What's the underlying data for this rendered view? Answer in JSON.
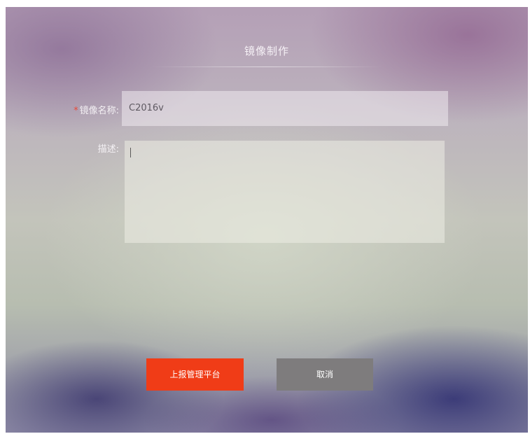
{
  "dialog": {
    "title": "镜像制作"
  },
  "form": {
    "name": {
      "required_mark": "*",
      "label": "镜像名称:",
      "value": "C2016v"
    },
    "description": {
      "label": "描述:",
      "value": ""
    }
  },
  "buttons": {
    "submit_label": "上报管理平台",
    "cancel_label": "取消"
  },
  "colors": {
    "accent": "#f03c17",
    "cancel": "#7e7c7d",
    "required": "#e84a3a"
  }
}
